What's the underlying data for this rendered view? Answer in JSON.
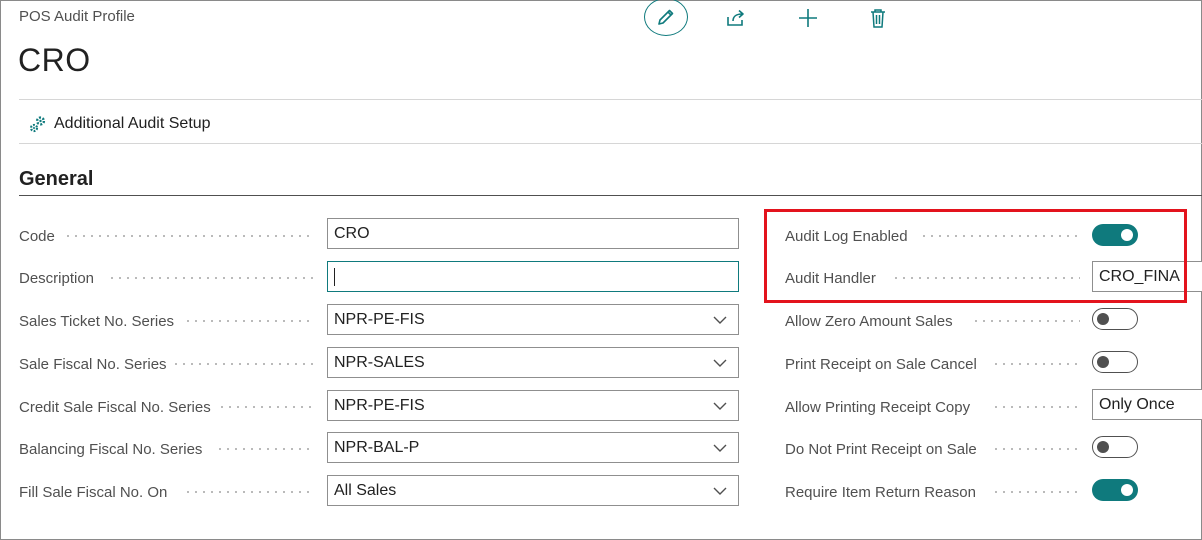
{
  "header": {
    "caption": "POS Audit Profile",
    "title": "CRO"
  },
  "toolbar": {
    "edit_icon": "pencil-icon",
    "share_icon": "share-icon",
    "new_icon": "plus-icon",
    "delete_icon": "trash-icon"
  },
  "actions": {
    "additional_audit_setup": "Additional Audit Setup"
  },
  "general": {
    "title": "General",
    "left_fields": [
      {
        "label": "Code",
        "value": "CRO",
        "type": "text"
      },
      {
        "label": "Description",
        "value": "",
        "type": "text-focused"
      },
      {
        "label": "Sales Ticket No. Series",
        "value": "NPR-PE-FIS",
        "type": "select"
      },
      {
        "label": "Sale Fiscal No. Series",
        "value": "NPR-SALES",
        "type": "select"
      },
      {
        "label": "Credit Sale Fiscal No. Series",
        "value": "NPR-PE-FIS",
        "type": "select"
      },
      {
        "label": "Balancing Fiscal No. Series",
        "value": "NPR-BAL-P",
        "type": "select"
      },
      {
        "label": "Fill Sale Fiscal No. On",
        "value": "All Sales",
        "type": "select"
      }
    ],
    "right_fields": [
      {
        "label": "Audit Log Enabled",
        "type": "toggle",
        "on": true
      },
      {
        "label": "Audit Handler",
        "type": "text",
        "value": "CRO_FINA"
      },
      {
        "label": "Allow Zero Amount Sales",
        "type": "toggle",
        "on": false
      },
      {
        "label": "Print Receipt on Sale Cancel",
        "type": "toggle",
        "on": false
      },
      {
        "label": "Allow Printing Receipt Copy",
        "type": "text",
        "value": "Only Once"
      },
      {
        "label": "Do Not Print Receipt on Sale",
        "type": "toggle",
        "on": false
      },
      {
        "label": "Require Item Return Reason",
        "type": "toggle",
        "on": true
      }
    ]
  },
  "colors": {
    "accent": "#0f7a7d",
    "highlight": "#e3131d"
  }
}
